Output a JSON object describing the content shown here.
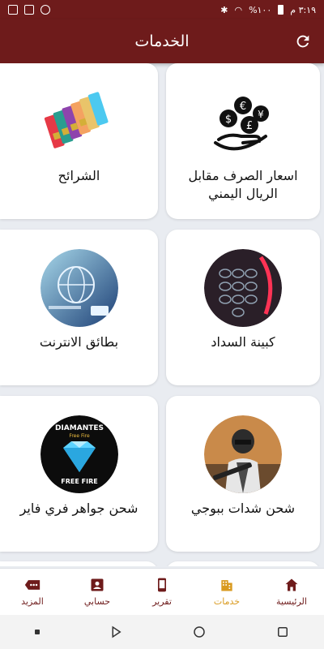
{
  "status_bar": {
    "time": "٣:١٩ م",
    "battery": "%١٠٠"
  },
  "header": {
    "title": "الخدمات"
  },
  "services": [
    {
      "label": "اسعار الصرف مقابل الريال اليمني",
      "icon": "currency-exchange-icon"
    },
    {
      "label": "الشرائح",
      "icon": "sim-cards-icon"
    },
    {
      "label": "كبينة السداد",
      "icon": "payment-keypad-icon"
    },
    {
      "label": "بطائق الانترنت",
      "icon": "internet-card-icon"
    },
    {
      "label": "شحن شدات ببوجي",
      "icon": "pubg-soldier-icon"
    },
    {
      "label": "شحن جواهر فري فاير",
      "icon": "free-fire-diamond-icon"
    }
  ],
  "free_fire_art": {
    "top": "DIAMANTES",
    "sub": "Free Fire",
    "bottom": "FREE FIRE"
  },
  "nav": {
    "home": "الرئيسية",
    "services": "خدمات",
    "report": "تقرير",
    "account": "حسابي",
    "more": "المزيد"
  },
  "colors": {
    "primary": "#6e1b1b",
    "active": "#d99a1f",
    "background": "#e9ecf1"
  }
}
